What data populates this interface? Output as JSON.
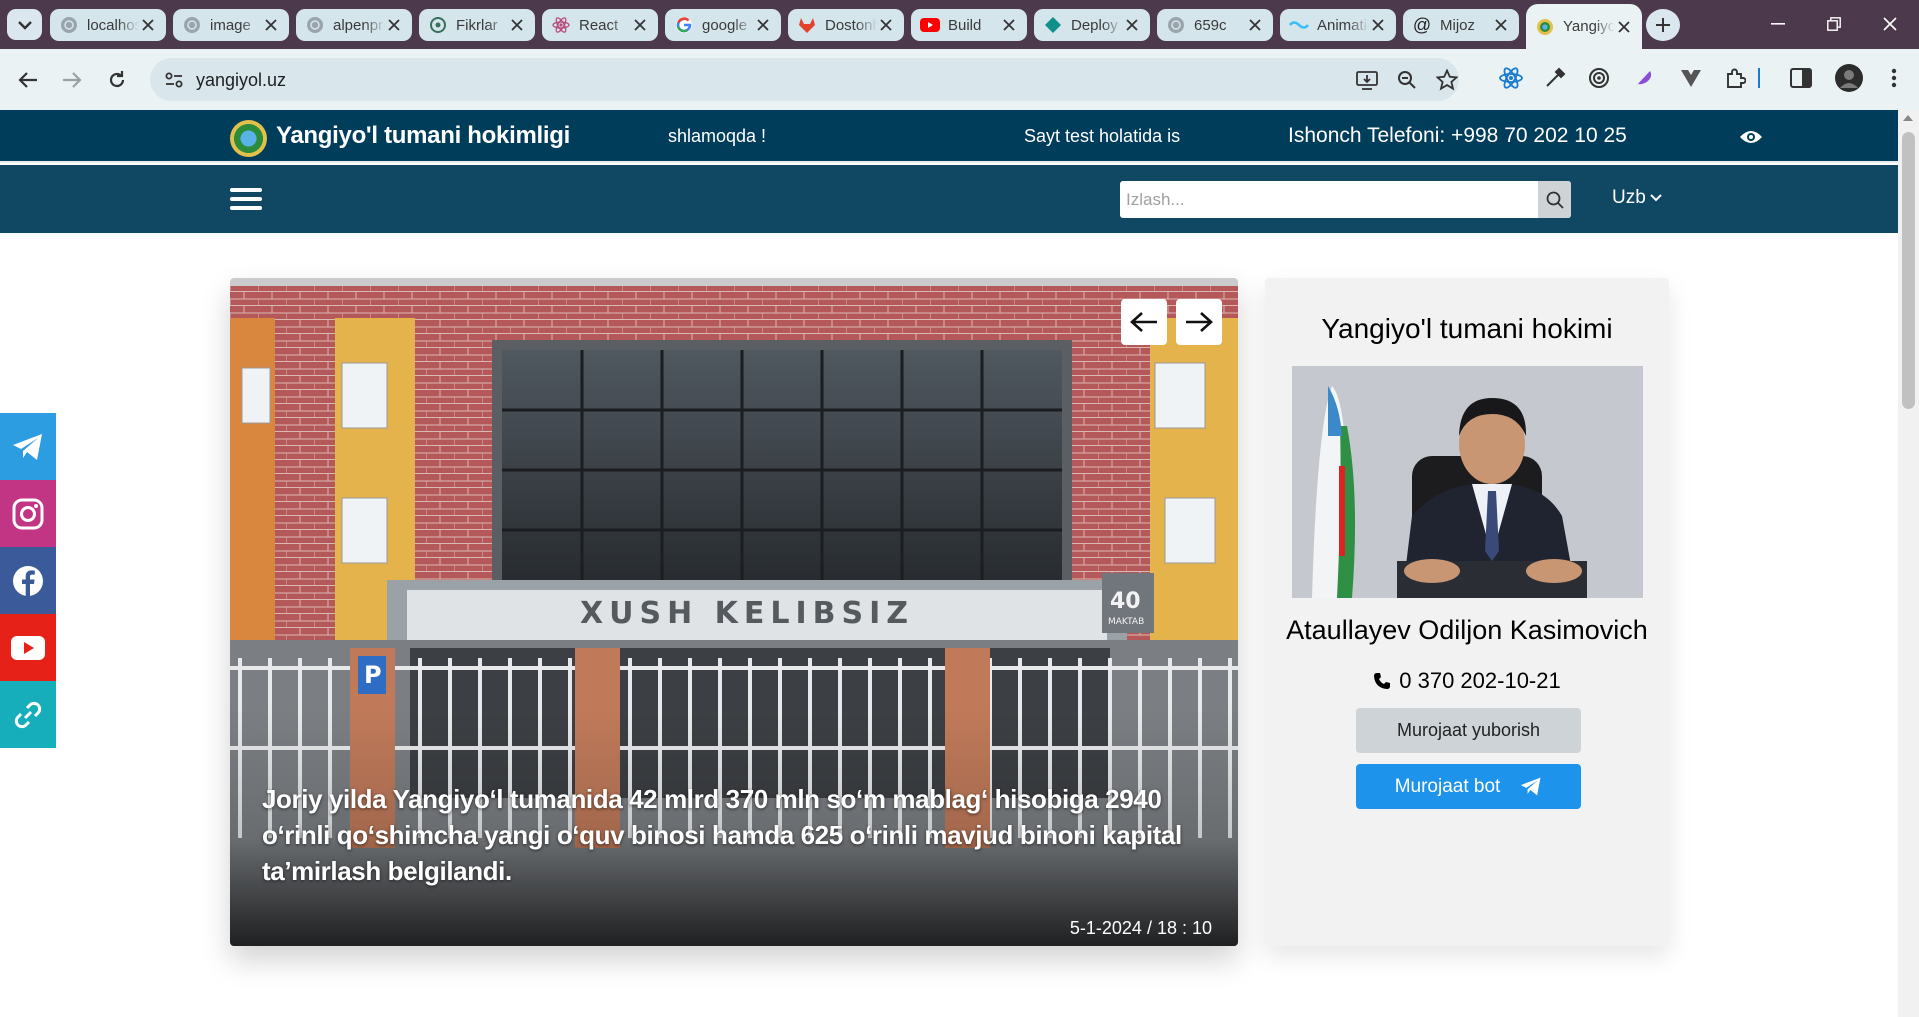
{
  "browser": {
    "tabs": [
      {
        "title": "localhost",
        "icon": "globe-icon"
      },
      {
        "title": "image",
        "icon": "globe-icon"
      },
      {
        "title": "alpenpro",
        "icon": "globe-icon"
      },
      {
        "title": "Fikrlar",
        "icon": "openai-icon"
      },
      {
        "title": "React",
        "icon": "react-icon"
      },
      {
        "title": "google",
        "icon": "google-icon"
      },
      {
        "title": "Dostonbek",
        "icon": "gitlab-icon"
      },
      {
        "title": "Build",
        "icon": "youtube-icon"
      },
      {
        "title": "Deploy",
        "icon": "netlify-icon"
      },
      {
        "title": "659c",
        "icon": "globe-icon"
      },
      {
        "title": "Animation",
        "icon": "tailwind-icon"
      },
      {
        "title": "Mijoz",
        "icon": "at-icon"
      },
      {
        "title": "Yangiyol",
        "icon": "site-logo-icon",
        "active": true
      }
    ],
    "url": "yangiyol.uz"
  },
  "site": {
    "title": "Yangiyo'l tumani hokimligi",
    "marquee_part1": "shlamoqda !",
    "marquee_part2": "Sayt test holatida is",
    "hotline": "Ishonch Telefoni: +998 70 202 10 25",
    "search_placeholder": "Izlash...",
    "language": "Uzb"
  },
  "news": {
    "building_sign": "XUSH KELIBSIZ",
    "school_badge": "40",
    "school_badge_sub": "MAKTAB",
    "caption": "Joriy yilda Yangiyo‘l tumanida 42 mlrd 370 mln so‘m mablag‘ hisobiga 2940 o‘rinli qo‘shimcha yangi o‘quv binosi hamda 625 o‘rinli mavjud binoni kapital ta’mirlash belgilandi.",
    "date": "5-1-2024 / 18 : 10"
  },
  "hokim": {
    "heading": "Yangiyo'l tumani hokimi",
    "name": "Ataullayev Odiljon Kasimovich",
    "phone": "0 370 202-10-21",
    "appeal_button": "Murojaat yuborish",
    "bot_button": "Murojaat bot"
  },
  "colors": {
    "topbar": "#003d5b",
    "navbar": "#104863",
    "bot_button": "#1d93ec",
    "telegram": "#2c9de0",
    "instagram": "#c13584",
    "facebook": "#3b5a9a",
    "youtube": "#e62117",
    "link": "#17aebb"
  }
}
